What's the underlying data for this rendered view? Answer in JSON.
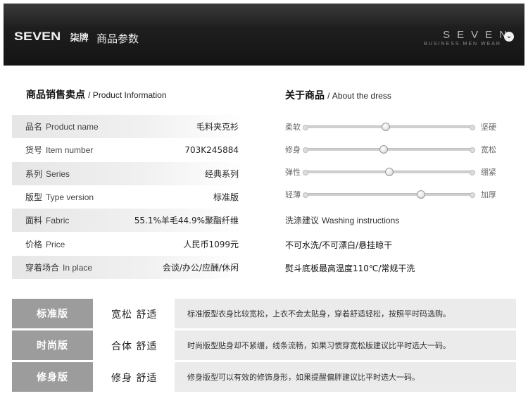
{
  "header": {
    "logo_text": "SEVEN",
    "logo_cn": "柒牌",
    "title": "商品参数",
    "brand_word": "SEVEN",
    "brand_sub": "BUSINESS MEN WEAR"
  },
  "product_info": {
    "title_cn": "商品销售卖点",
    "title_en": "/ Product Information",
    "rows": [
      {
        "label_cn": "品名",
        "label_en": "Product name",
        "value": "毛料夹克衫"
      },
      {
        "label_cn": "货号",
        "label_en": "Item number",
        "value": "703K245884"
      },
      {
        "label_cn": "系列",
        "label_en": "Series",
        "value": "经典系列"
      },
      {
        "label_cn": "版型",
        "label_en": "Type version",
        "value": "标准版"
      },
      {
        "label_cn": "面料",
        "label_en": "Fabric",
        "value": "55.1%羊毛44.9%聚酯纤维"
      },
      {
        "label_cn": "价格",
        "label_en": "Price",
        "value": "人民币1099元"
      },
      {
        "label_cn": "穿着场合",
        "label_en": "In place",
        "value": "会谈/办公/应酬/休闲"
      }
    ]
  },
  "about": {
    "title_cn": "关于商品",
    "title_en": "/ About the dress",
    "sliders": [
      {
        "left": "柔软",
        "right": "坚硬",
        "level": 0.48
      },
      {
        "left": "修身",
        "right": "宽松",
        "level": 0.47
      },
      {
        "left": "弹性",
        "right": "绷紧",
        "level": 0.5
      },
      {
        "left": "轻薄",
        "right": "加厚",
        "level": 0.69
      }
    ],
    "wash_title_cn": "洗涤建议",
    "wash_title_en": "Washing instructions",
    "wash_lines": [
      "不可水洗/不可漂白/悬挂晾干",
      "熨斗底板最高温度110℃/常规干洗"
    ]
  },
  "versions": [
    {
      "tag": "标准版",
      "fit": "宽松 舒适",
      "desc": "标准版型衣身比较宽松，上衣不会太贴身，穿着舒适轻松，按照平时码选购。"
    },
    {
      "tag": "时尚版",
      "fit": "合体 舒适",
      "desc": "时尚版型贴身却不紧绷，线条流畅，如果习惯穿宽松版建议比平时选大一码。"
    },
    {
      "tag": "修身版",
      "fit": "修身 舒适",
      "desc": "修身版型可以有效的修饰身形，如果提醒偏胖建议比平时选大一码。"
    }
  ]
}
